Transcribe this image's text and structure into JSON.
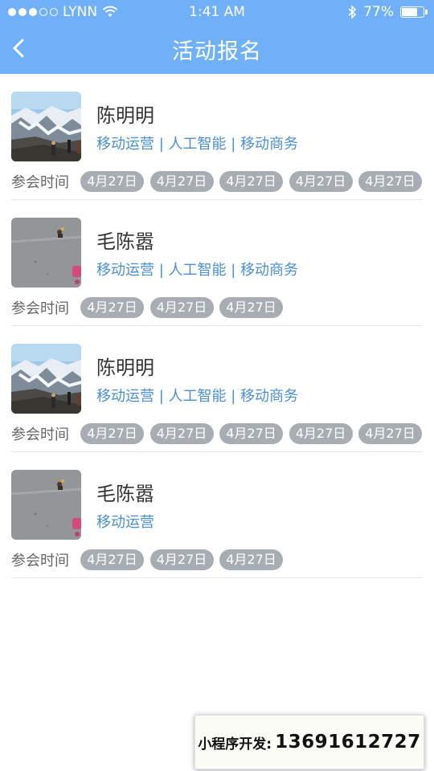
{
  "status_bar": {
    "carrier": "LYNN",
    "time": "1:41 AM",
    "battery": "77%",
    "battery_level": 0.77
  },
  "nav": {
    "title": "活动报名"
  },
  "time_label": "参会时间",
  "entries": [
    {
      "name": "陈明明",
      "tags": "移动运营 | 人工智能 | 移动商务",
      "photo": "mountain-photo",
      "dates": [
        "4月27日",
        "4月27日",
        "4月27日",
        "4月27日",
        "4月27日"
      ]
    },
    {
      "name": "毛陈嚣",
      "tags": "移动运营 | 人工智能 | 移动商务",
      "photo": "street-photo",
      "dates": [
        "4月27日",
        "4月27日",
        "4月27日"
      ]
    },
    {
      "name": "陈明明",
      "tags": "移动运营 | 人工智能 | 移动商务",
      "photo": "mountain-photo",
      "dates": [
        "4月27日",
        "4月27日",
        "4月27日",
        "4月27日",
        "4月27日"
      ]
    },
    {
      "name": "毛陈嚣",
      "tags": "移动运营",
      "photo": "street-photo",
      "dates": [
        "4月27日",
        "4月27日",
        "4月27日"
      ]
    }
  ],
  "promo": {
    "label": "小程序开发:",
    "phone": "13691612727"
  },
  "colors": {
    "header": "#6fb0f8",
    "tag_text": "#4a8fd6",
    "chip": "#a7adb2"
  }
}
